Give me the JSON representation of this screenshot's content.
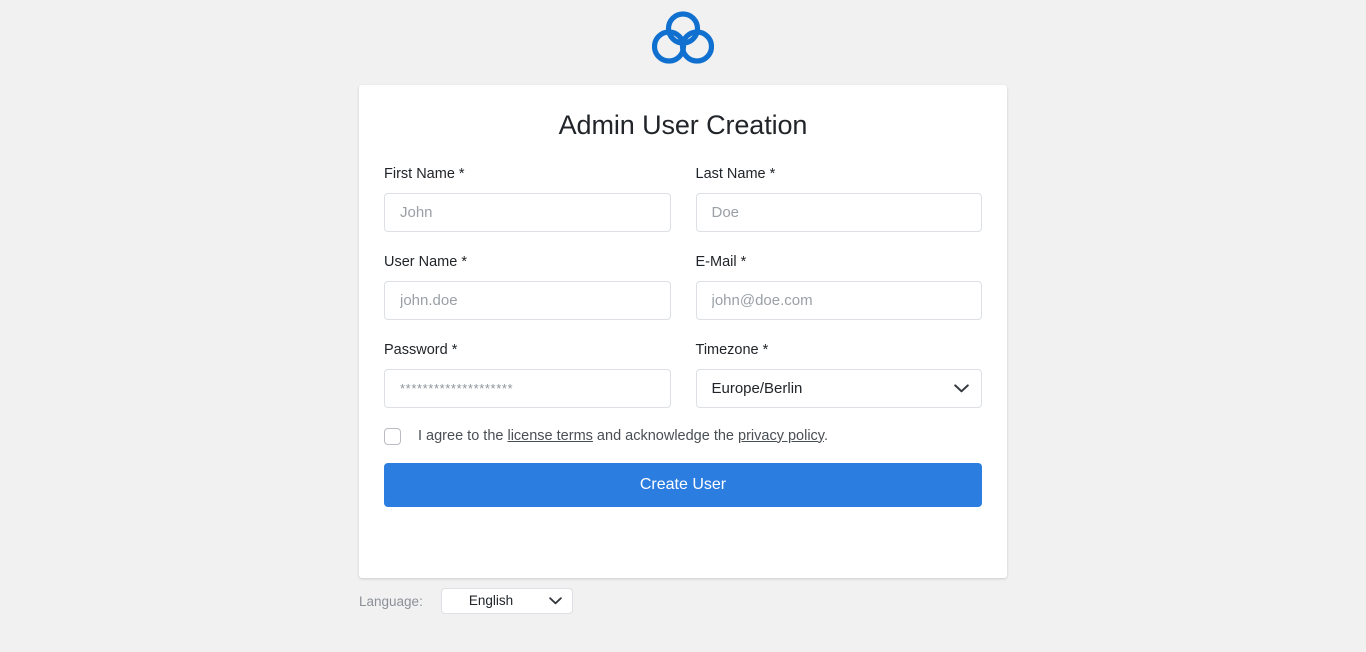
{
  "brand": {
    "logo_icon": "trefoil-cloud-logo-icon",
    "logo_color": "#1070d0"
  },
  "card": {
    "title": "Admin User Creation"
  },
  "form": {
    "fields": [
      {
        "name": "first-name",
        "label": "First Name *",
        "placeholder": "John",
        "value": "",
        "type": "text"
      },
      {
        "name": "last-name",
        "label": "Last Name *",
        "placeholder": "Doe",
        "value": "",
        "type": "text"
      },
      {
        "name": "user-name",
        "label": "User Name *",
        "placeholder": "john.doe",
        "value": "",
        "type": "text"
      },
      {
        "name": "email",
        "label": "E-Mail *",
        "placeholder": "john@doe.com",
        "value": "",
        "type": "text"
      },
      {
        "name": "password",
        "label": "Password *",
        "placeholder": "********************",
        "value": "",
        "type": "password"
      },
      {
        "name": "timezone",
        "label": "Timezone *",
        "selected": "Europe/Berlin",
        "type": "select",
        "options": [
          "Europe/Berlin"
        ],
        "chevron_icon": "chevron-down-icon"
      }
    ],
    "agreement": {
      "checked": false,
      "text_before": "I agree to the ",
      "link_license": "license terms",
      "text_middle": " and acknowledge the ",
      "link_privacy": "privacy policy",
      "text_after": "."
    },
    "submit_label": "Create User",
    "submit_color": "#2b7de0"
  },
  "footer": {
    "language_label": "Language:",
    "language_selected": "English",
    "language_options": [
      "English"
    ],
    "chevron_icon": "chevron-down-icon"
  }
}
